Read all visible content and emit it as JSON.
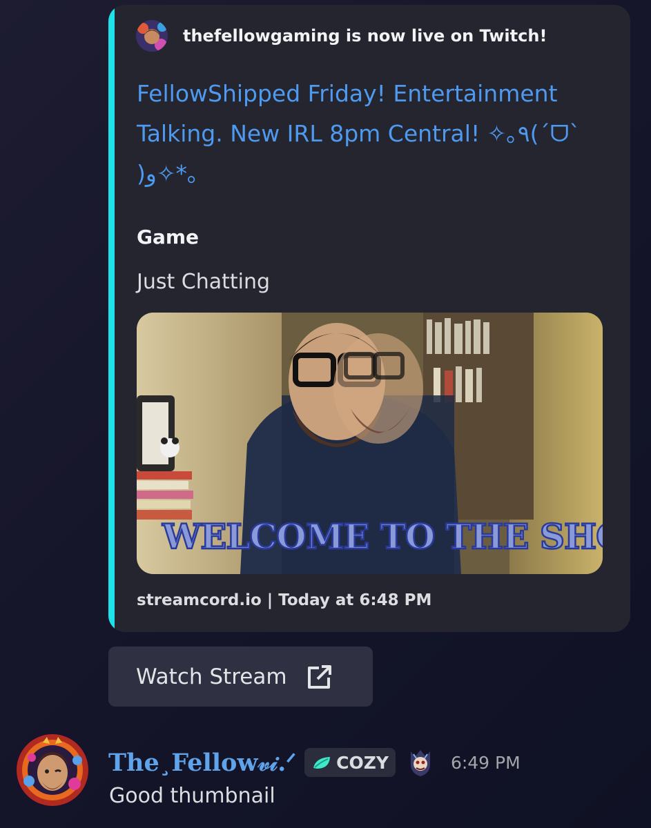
{
  "embed": {
    "accent_color": "#1ee1ea",
    "author": "thefellowgaming is now live on Twitch!",
    "title": "FellowShipped Friday! Entertainment Talking. New IRL 8pm Central! ✧｡٩(ˊᗜˋ )و✧*｡",
    "field_name": "Game",
    "field_value": "Just Chatting",
    "thumbnail_overlay_text": "WELCOME TO THE SHOW",
    "footer": "streamcord.io | Today at 6:48 PM"
  },
  "watch_button": {
    "label": "Watch Stream",
    "icon": "external-link-icon"
  },
  "message": {
    "username": "The¸Fellow𝓋𝒾.ᐟ",
    "username_color": "#5fa3ea",
    "tag_icon": "leaf-icon",
    "tag": "COZY",
    "role_icon": "crest-icon",
    "timestamp": "6:49 PM",
    "content": "Good thumbnail"
  }
}
